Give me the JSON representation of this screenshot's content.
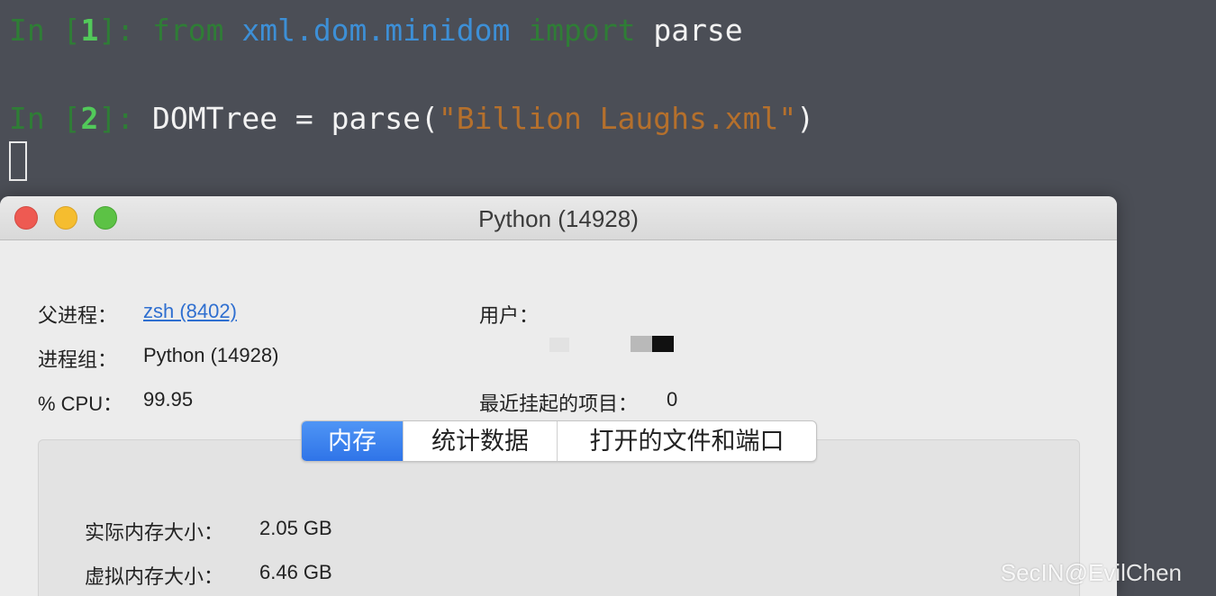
{
  "terminal": {
    "line1": {
      "prompt_in": "In [",
      "prompt_num": "1",
      "prompt_close": "]:",
      "kw_from": "from",
      "module": "xml.dom.minidom",
      "kw_import": "import",
      "name": "parse"
    },
    "line2": {
      "prompt_in": "In [",
      "prompt_num": "2",
      "prompt_close": "]:",
      "code_before": "DOMTree = parse(",
      "string": "\"Billion Laughs.xml\"",
      "code_after": ")"
    }
  },
  "window": {
    "title": "Python (14928)",
    "fields": {
      "parent_label": "父进程：",
      "parent_value": "zsh (8402)",
      "user_label": "用户：",
      "group_label": "进程组：",
      "group_value": "Python (14928)",
      "cpu_label": "% CPU：",
      "cpu_value": "99.95",
      "recent_label": "最近挂起的项目：",
      "recent_value": "0"
    },
    "tabs": [
      {
        "label": "内存",
        "active": true
      },
      {
        "label": "统计数据",
        "active": false
      },
      {
        "label": "打开的文件和端口",
        "active": false
      }
    ],
    "memory": {
      "real_label": "实际内存大小：",
      "real_value": "2.05 GB",
      "virtual_label": "虚拟内存大小：",
      "virtual_value": "6.46 GB"
    }
  },
  "watermark": "SecIN@EvilChen",
  "colors": {
    "terminal_bg": "#4b4e56",
    "prompt_green": "#2f7d36",
    "module_blue": "#3d8fd6",
    "string_orange": "#b5702c",
    "tab_active_blue": "#2f74e8",
    "link_blue": "#2f6fd0"
  }
}
